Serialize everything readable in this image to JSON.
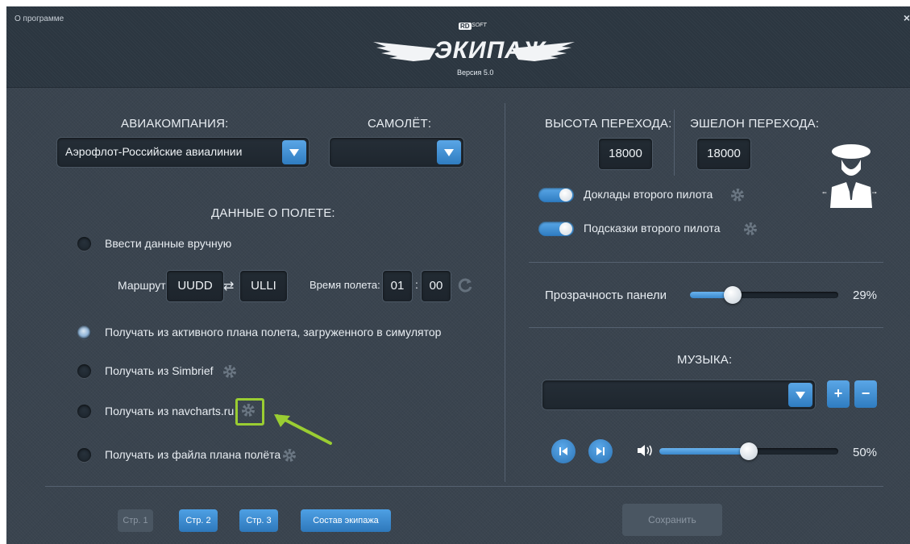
{
  "header": {
    "about": "О программе",
    "close": "×",
    "logo_brand": "ЭКИПАЖ",
    "logo_rd": "RD",
    "logo_soft": "SOFT",
    "version": "Версия 5.0"
  },
  "left": {
    "airline_label": "АВИАКОМПАНИЯ:",
    "airline_value": "Аэрофлот-Российские авиалинии",
    "aircraft_label": "САМОЛЁТ:",
    "aircraft_value": "",
    "flight_data_label": "ДАННЫЕ О ПОЛЕТЕ:",
    "options": {
      "manual": "Ввести данные вручную",
      "sim": "Получать из активного плана полета, загруженного в симулятор",
      "simbrief": "Получать из Simbrief",
      "navcharts": "Получать из navcharts.ru",
      "file": "Получать из файла плана полёта"
    },
    "selected_option": "sim",
    "route_label": "Маршрут:",
    "route_from": "UUDD",
    "route_swap": "⇄",
    "route_to": "ULLI",
    "time_label": "Время полета:",
    "time_hours": "01",
    "time_sep": ":",
    "time_minutes": "00"
  },
  "right": {
    "transition_alt_label": "ВЫСОТА ПЕРЕХОДА:",
    "transition_alt_value": "18000",
    "transition_level_label": "ЭШЕЛОН ПЕРЕХОДА:",
    "transition_level_value": "18000",
    "copilot_reports": "Доклады второго пилота",
    "copilot_hints": "Подсказки второго пилота",
    "panel_opacity_label": "Прозрачность панели",
    "panel_opacity_value": "29%",
    "panel_opacity_fraction": 0.29,
    "music_label": "МУЗЫКА:",
    "music_track": "",
    "plus": "+",
    "minus": "−",
    "volume_value": "50%",
    "volume_fraction": 0.5
  },
  "footer": {
    "page1": "Стр. 1",
    "page2": "Стр. 2",
    "page3": "Стр. 3",
    "crew": "Состав экипажа",
    "save": "Сохранить"
  },
  "colors": {
    "accent": "#3a8ad0",
    "highlight": "#9acd32",
    "background": "#3a444f"
  }
}
